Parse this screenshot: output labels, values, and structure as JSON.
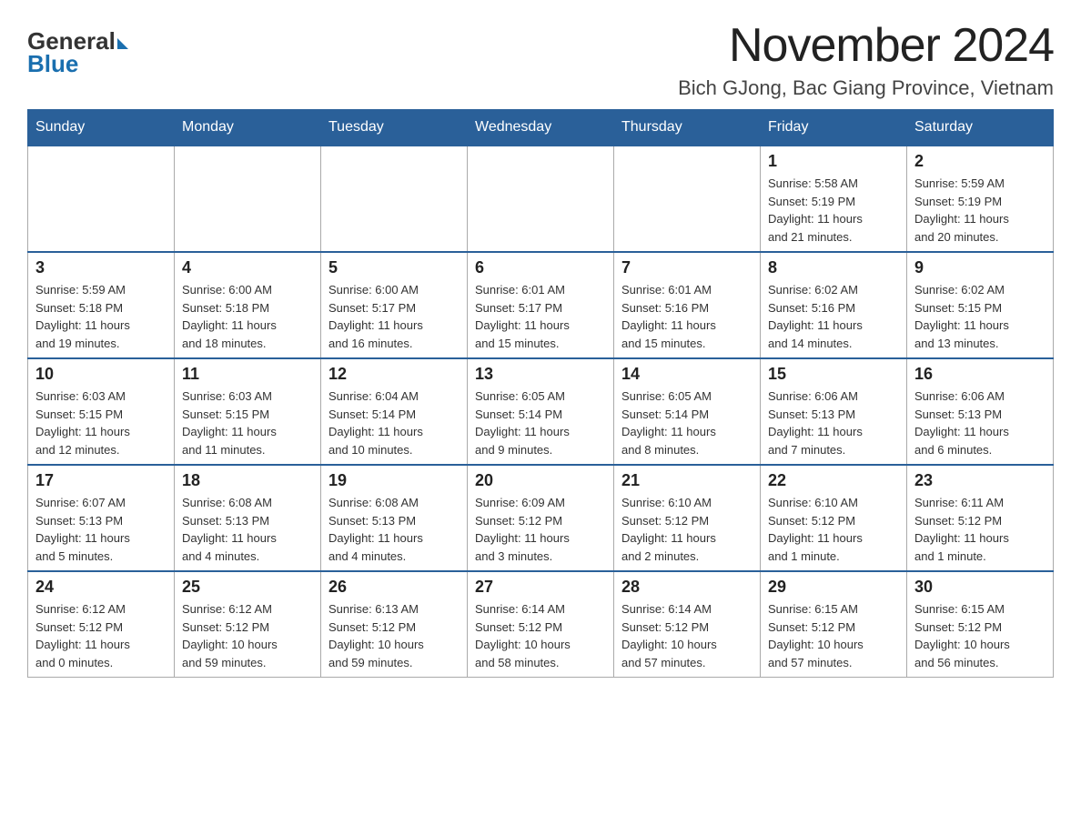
{
  "logo": {
    "general": "General",
    "blue": "Blue"
  },
  "title": "November 2024",
  "subtitle": "Bich GJong, Bac Giang Province, Vietnam",
  "days_of_week": [
    "Sunday",
    "Monday",
    "Tuesday",
    "Wednesday",
    "Thursday",
    "Friday",
    "Saturday"
  ],
  "weeks": [
    [
      {
        "day": "",
        "info": ""
      },
      {
        "day": "",
        "info": ""
      },
      {
        "day": "",
        "info": ""
      },
      {
        "day": "",
        "info": ""
      },
      {
        "day": "",
        "info": ""
      },
      {
        "day": "1",
        "info": "Sunrise: 5:58 AM\nSunset: 5:19 PM\nDaylight: 11 hours\nand 21 minutes."
      },
      {
        "day": "2",
        "info": "Sunrise: 5:59 AM\nSunset: 5:19 PM\nDaylight: 11 hours\nand 20 minutes."
      }
    ],
    [
      {
        "day": "3",
        "info": "Sunrise: 5:59 AM\nSunset: 5:18 PM\nDaylight: 11 hours\nand 19 minutes."
      },
      {
        "day": "4",
        "info": "Sunrise: 6:00 AM\nSunset: 5:18 PM\nDaylight: 11 hours\nand 18 minutes."
      },
      {
        "day": "5",
        "info": "Sunrise: 6:00 AM\nSunset: 5:17 PM\nDaylight: 11 hours\nand 16 minutes."
      },
      {
        "day": "6",
        "info": "Sunrise: 6:01 AM\nSunset: 5:17 PM\nDaylight: 11 hours\nand 15 minutes."
      },
      {
        "day": "7",
        "info": "Sunrise: 6:01 AM\nSunset: 5:16 PM\nDaylight: 11 hours\nand 15 minutes."
      },
      {
        "day": "8",
        "info": "Sunrise: 6:02 AM\nSunset: 5:16 PM\nDaylight: 11 hours\nand 14 minutes."
      },
      {
        "day": "9",
        "info": "Sunrise: 6:02 AM\nSunset: 5:15 PM\nDaylight: 11 hours\nand 13 minutes."
      }
    ],
    [
      {
        "day": "10",
        "info": "Sunrise: 6:03 AM\nSunset: 5:15 PM\nDaylight: 11 hours\nand 12 minutes."
      },
      {
        "day": "11",
        "info": "Sunrise: 6:03 AM\nSunset: 5:15 PM\nDaylight: 11 hours\nand 11 minutes."
      },
      {
        "day": "12",
        "info": "Sunrise: 6:04 AM\nSunset: 5:14 PM\nDaylight: 11 hours\nand 10 minutes."
      },
      {
        "day": "13",
        "info": "Sunrise: 6:05 AM\nSunset: 5:14 PM\nDaylight: 11 hours\nand 9 minutes."
      },
      {
        "day": "14",
        "info": "Sunrise: 6:05 AM\nSunset: 5:14 PM\nDaylight: 11 hours\nand 8 minutes."
      },
      {
        "day": "15",
        "info": "Sunrise: 6:06 AM\nSunset: 5:13 PM\nDaylight: 11 hours\nand 7 minutes."
      },
      {
        "day": "16",
        "info": "Sunrise: 6:06 AM\nSunset: 5:13 PM\nDaylight: 11 hours\nand 6 minutes."
      }
    ],
    [
      {
        "day": "17",
        "info": "Sunrise: 6:07 AM\nSunset: 5:13 PM\nDaylight: 11 hours\nand 5 minutes."
      },
      {
        "day": "18",
        "info": "Sunrise: 6:08 AM\nSunset: 5:13 PM\nDaylight: 11 hours\nand 4 minutes."
      },
      {
        "day": "19",
        "info": "Sunrise: 6:08 AM\nSunset: 5:13 PM\nDaylight: 11 hours\nand 4 minutes."
      },
      {
        "day": "20",
        "info": "Sunrise: 6:09 AM\nSunset: 5:12 PM\nDaylight: 11 hours\nand 3 minutes."
      },
      {
        "day": "21",
        "info": "Sunrise: 6:10 AM\nSunset: 5:12 PM\nDaylight: 11 hours\nand 2 minutes."
      },
      {
        "day": "22",
        "info": "Sunrise: 6:10 AM\nSunset: 5:12 PM\nDaylight: 11 hours\nand 1 minute."
      },
      {
        "day": "23",
        "info": "Sunrise: 6:11 AM\nSunset: 5:12 PM\nDaylight: 11 hours\nand 1 minute."
      }
    ],
    [
      {
        "day": "24",
        "info": "Sunrise: 6:12 AM\nSunset: 5:12 PM\nDaylight: 11 hours\nand 0 minutes."
      },
      {
        "day": "25",
        "info": "Sunrise: 6:12 AM\nSunset: 5:12 PM\nDaylight: 10 hours\nand 59 minutes."
      },
      {
        "day": "26",
        "info": "Sunrise: 6:13 AM\nSunset: 5:12 PM\nDaylight: 10 hours\nand 59 minutes."
      },
      {
        "day": "27",
        "info": "Sunrise: 6:14 AM\nSunset: 5:12 PM\nDaylight: 10 hours\nand 58 minutes."
      },
      {
        "day": "28",
        "info": "Sunrise: 6:14 AM\nSunset: 5:12 PM\nDaylight: 10 hours\nand 57 minutes."
      },
      {
        "day": "29",
        "info": "Sunrise: 6:15 AM\nSunset: 5:12 PM\nDaylight: 10 hours\nand 57 minutes."
      },
      {
        "day": "30",
        "info": "Sunrise: 6:15 AM\nSunset: 5:12 PM\nDaylight: 10 hours\nand 56 minutes."
      }
    ]
  ]
}
